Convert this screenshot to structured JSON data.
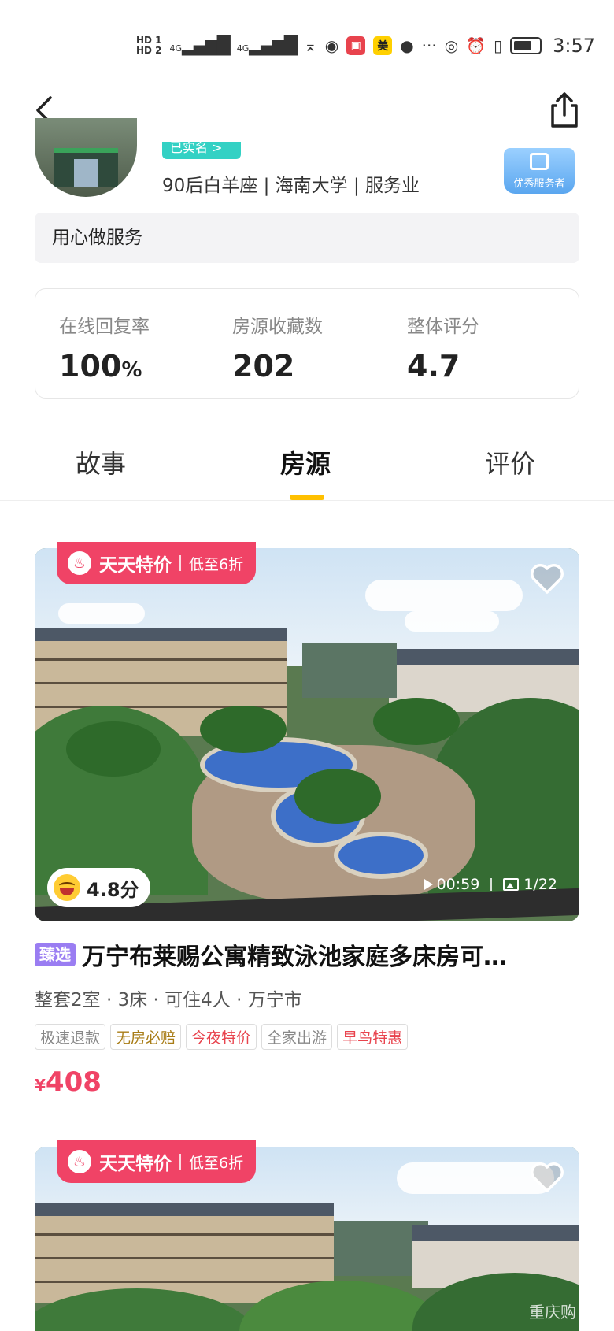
{
  "status_bar": {
    "hd1": "HD 1",
    "hd2": "HD 2",
    "signal1": "4G",
    "signal2": "4G",
    "app_badge_mei": "美",
    "time": "3:57"
  },
  "host": {
    "verified_tag": "已实名 >",
    "info": "90后白羊座 | 海南大学 | 服务业",
    "badge": "优秀服务者",
    "motto": "用心做服务"
  },
  "stats": [
    {
      "label": "在线回复率",
      "value": "100",
      "unit": "%"
    },
    {
      "label": "房源收藏数",
      "value": "202",
      "unit": ""
    },
    {
      "label": "整体评分",
      "value": "4.7",
      "unit": ""
    }
  ],
  "tabs": [
    {
      "label": "故事"
    },
    {
      "label": "房源"
    },
    {
      "label": "评价"
    }
  ],
  "active_tab": "房源",
  "listings": [
    {
      "promo_title": "天天特价",
      "promo_sub": "低至6折",
      "fire_glyph": "♨",
      "rating": "4.8分",
      "video_duration": "00:59",
      "photo_count": "1/22",
      "select_badge": "臻选",
      "title": "万宁布莱赐公寓精致泳池家庭多床房可…",
      "meta": "整套2室 · 3床 · 可住4人 · 万宁市",
      "tags": [
        {
          "text": "极速退款",
          "style": "gray"
        },
        {
          "text": "无房必赔",
          "style": "gold"
        },
        {
          "text": "今夜特价",
          "style": "red"
        },
        {
          "text": "全家出游",
          "style": "gray"
        },
        {
          "text": "早鸟特惠",
          "style": "red"
        }
      ],
      "currency": "¥",
      "price": "408"
    },
    {
      "promo_title": "天天特价",
      "promo_sub": "低至6折",
      "fire_glyph": "♨",
      "watermark": "重庆购"
    }
  ],
  "colors": {
    "accent_yellow": "#ffc000",
    "promo_pink": "#f04366",
    "select_purple": "#9a7df2",
    "verified_teal": "#33d1c4"
  },
  "icons": [
    "back-arrow-icon",
    "share-icon",
    "heart-icon",
    "play-icon",
    "image-icon",
    "fire-icon",
    "laugh-emoji-icon"
  ]
}
